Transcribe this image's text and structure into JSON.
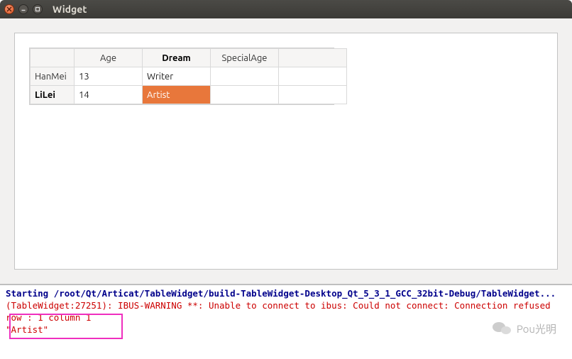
{
  "window": {
    "title": "Widget"
  },
  "table": {
    "columns": [
      "Age",
      "Dream",
      "SpecialAge"
    ],
    "bold_column_index": 1,
    "rows": [
      {
        "header": "HanMei",
        "bold": false,
        "cells": [
          "13",
          "Writer",
          ""
        ]
      },
      {
        "header": "LiLei",
        "bold": true,
        "cells": [
          "14",
          "Artist",
          ""
        ]
      }
    ],
    "selected": {
      "row": 1,
      "col": 1
    }
  },
  "output": {
    "lines": [
      {
        "cls": "navy",
        "text": "Starting /root/Qt/Articat/TableWidget/build-TableWidget-Desktop_Qt_5_3_1_GCC_32bit-Debug/TableWidget..."
      },
      {
        "cls": "",
        "text": ""
      },
      {
        "cls": "red",
        "text": "(TableWidget:27251): IBUS-WARNING **: Unable to connect to ibus: Could not connect: Connection refused"
      },
      {
        "cls": "red",
        "text": "row : 1 column 1"
      },
      {
        "cls": "red",
        "text": "\"Artist\""
      }
    ]
  },
  "watermark": {
    "text": "Pou光明"
  }
}
